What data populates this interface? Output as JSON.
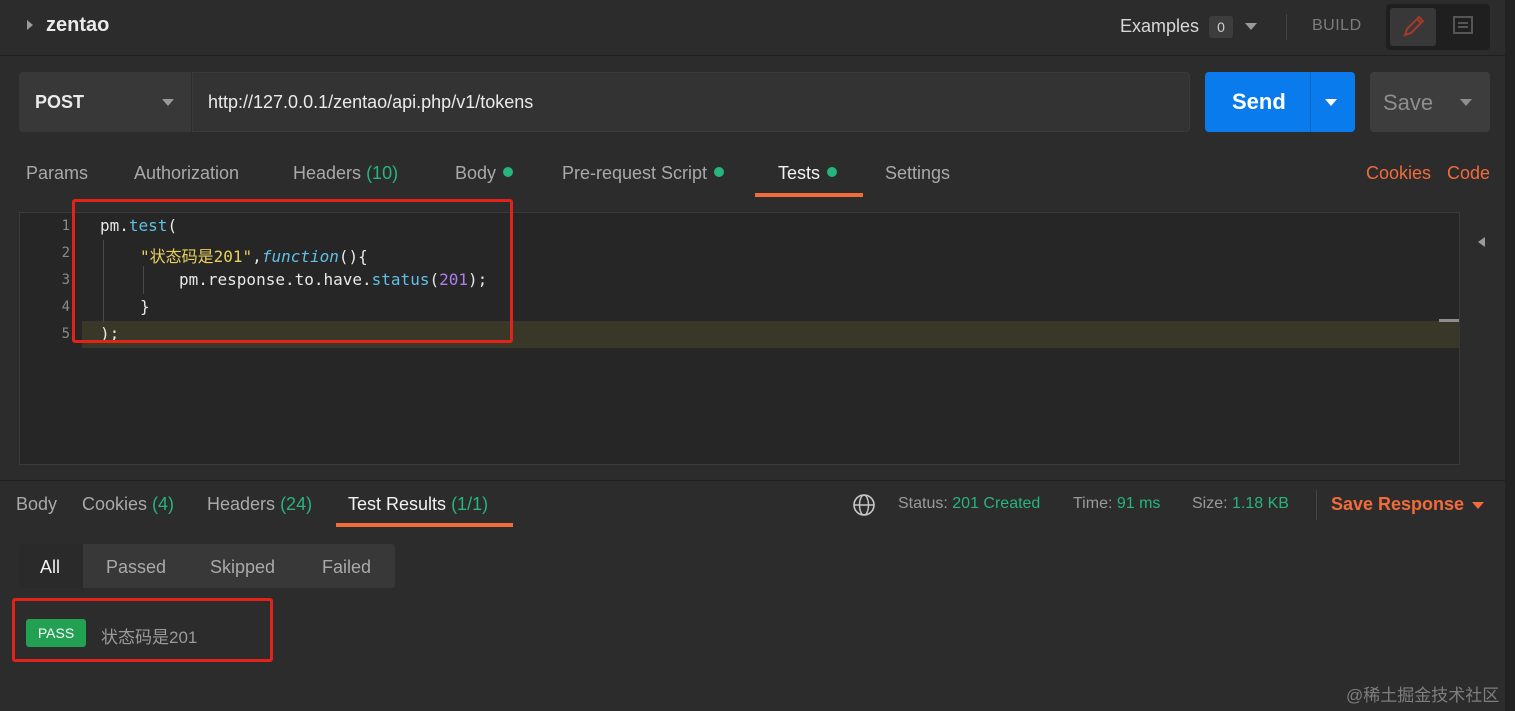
{
  "header": {
    "collection_name": "zentao",
    "examples_label": "Examples",
    "examples_count": "0",
    "build_label": "BUILD"
  },
  "request": {
    "method": "POST",
    "url": "http://127.0.0.1/zentao/api.php/v1/tokens",
    "send_label": "Send",
    "save_label": "Save"
  },
  "request_tabs": {
    "params": "Params",
    "authorization": "Authorization",
    "headers": "Headers",
    "headers_count": "(10)",
    "body": "Body",
    "prerequest": "Pre-request Script",
    "tests": "Tests",
    "settings": "Settings",
    "cookies": "Cookies",
    "code": "Code"
  },
  "editor": {
    "line_numbers": [
      "1",
      "2",
      "3",
      "4",
      "5"
    ],
    "line1": {
      "obj": "pm",
      "dot": ".",
      "fn": "test",
      "paren": "("
    },
    "line2": {
      "str": "\"状态码是201\"",
      "comma": ",",
      "kw": "function",
      "rest": "(){"
    },
    "line3": {
      "chain": "pm.response.to.have.",
      "fn": "status",
      "open": "(",
      "num": "201",
      "close": ");"
    },
    "line4": "}",
    "line5": ");"
  },
  "response": {
    "tabs": {
      "body": "Body",
      "cookies": "Cookies",
      "cookies_count": "(4)",
      "headers": "Headers",
      "headers_count": "(24)",
      "test_results": "Test Results",
      "test_results_count": "(1/1)"
    },
    "status_label": "Status:",
    "status_value": "201 Created",
    "time_label": "Time:",
    "time_value": "91 ms",
    "size_label": "Size:",
    "size_value": "1.18 KB",
    "save_response": "Save Response"
  },
  "filters": {
    "all": "All",
    "passed": "Passed",
    "skipped": "Skipped",
    "failed": "Failed"
  },
  "results": [
    {
      "badge": "PASS",
      "name": "状态码是201"
    }
  ],
  "watermark": "@稀土掘金技术社区",
  "colors": {
    "accent_orange": "#f26b3a",
    "send_blue": "#097bed",
    "success_green": "#26b47f",
    "pass_green": "#23a152",
    "annotation_red": "#e2231a"
  }
}
